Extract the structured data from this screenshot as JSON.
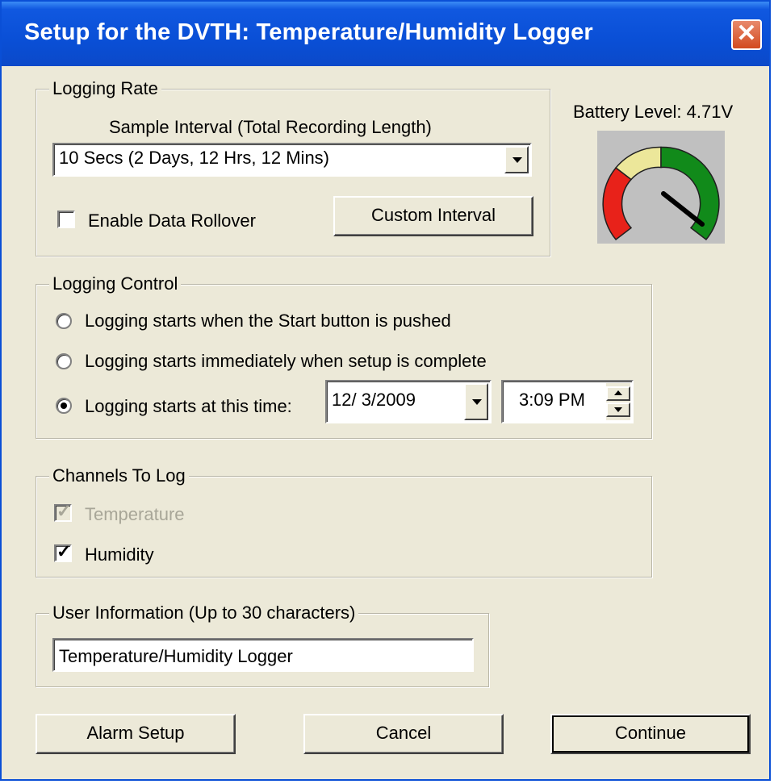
{
  "window": {
    "title": "Setup for the DVTH:  Temperature/Humidity Logger",
    "close_icon": "close-icon"
  },
  "logging_rate": {
    "legend": "Logging Rate",
    "sample_interval_label": "Sample Interval  (Total Recording Length)",
    "sample_interval_value": "10 Secs  (2 Days, 12 Hrs, 12 Mins)",
    "enable_rollover_label": "Enable Data Rollover",
    "enable_rollover_checked": false,
    "custom_interval_label": "Custom Interval"
  },
  "battery": {
    "label": "Battery Level: 4.71V",
    "colors": {
      "low": "#e8221a",
      "mid": "#ece79a",
      "high": "#118a1a",
      "face": "#c0c0c0"
    }
  },
  "logging_control": {
    "legend": "Logging Control",
    "options": [
      {
        "label": "Logging starts when the Start button is pushed",
        "selected": false
      },
      {
        "label": "Logging starts immediately when setup is complete",
        "selected": false
      },
      {
        "label": "Logging starts at this time:",
        "selected": true
      }
    ],
    "date_value": "12/  3/2009",
    "time_value": "3:09 PM"
  },
  "channels": {
    "legend": "Channels To Log",
    "items": [
      {
        "label": "Temperature",
        "checked": true,
        "disabled": true
      },
      {
        "label": "Humidity",
        "checked": true,
        "disabled": false
      }
    ]
  },
  "user_info": {
    "legend": "User Information (Up to 30 characters)",
    "value": "Temperature/Humidity Logger"
  },
  "buttons": {
    "alarm_setup": "Alarm Setup",
    "cancel": "Cancel",
    "continue": "Continue"
  }
}
